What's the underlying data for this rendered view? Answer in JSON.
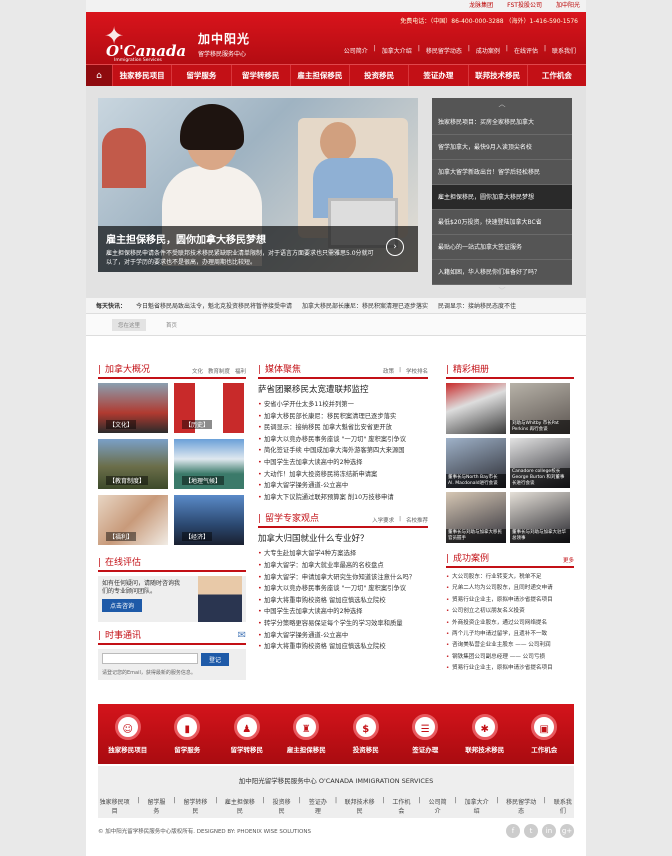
{
  "toplinks": [
    "龙脉集团",
    "FST投股公司",
    "加中阳光"
  ],
  "header": {
    "logo_en": "O'Canada",
    "logo_sub": "Immigration Services",
    "cn_title": "加中阳光",
    "cn_sub": "留学移民服务中心",
    "phone": "免费电话：（中国）86-400-000-3288 （海外）1-416-590-1576",
    "subnav": [
      "公司简介",
      "加拿大介绍",
      "移民留学动态",
      "成功案例",
      "在线评估",
      "联系我们"
    ]
  },
  "nav": [
    "独家移民项目",
    "留学服务",
    "留学转移民",
    "雇主担保移民",
    "投资移民",
    "签证办理",
    "联邦技术移民",
    "工作机会"
  ],
  "hero": {
    "title": "雇主担保移民，圆你加拿大移民梦想",
    "desc": "雇主担保移民申请条件不受联邦技术移民紧缺职业清单限制，对于语言方面要求也只需雅思5.0分就可以了，对于学历的要求也不是很高，办理周期也比较短。",
    "slides": [
      "独家移民项目：买房全家移民加拿大",
      "留学加拿大，最快9月入读顶尖名校",
      "加拿大留学新政出台！留学后轻松移民",
      "雇主担保移民，圆你加拿大移民梦想",
      "最低$20万投资，快速登陆加拿大BC省",
      "最贴心的一站式加拿大签证服务",
      "入籍如困，华人移民你们准备好了吗？"
    ]
  },
  "ticker": {
    "label": "每天快讯：",
    "items": [
      "今日魁省移民局致出法令，魁北克投资移民将暂停接受申请",
      "加拿大移民部长康尼：移民积案清理已逐步落实",
      "民调显示：接纳移民态度不佳"
    ]
  },
  "crumbs": [
    "您在这里",
    "首页"
  ],
  "col1": {
    "title": "加拿大概况",
    "tabs": [
      "文化",
      "教育制度",
      "福利"
    ],
    "tiles": [
      "【文化】",
      "【历史】",
      "【教育制度】",
      "【地理气候】",
      "【福利】",
      "【经济】"
    ],
    "assess_title": "在线评估",
    "assess_text": "如有任何疑问，请随时咨询我们的专业顾问团队。",
    "assess_btn": "点击咨询",
    "news_title": "时事通讯",
    "sub_btn": "登记",
    "sub_note": "请登记您的Email，获得最新的服务信息。"
  },
  "col2": {
    "title": "媒体聚焦",
    "tabs": [
      "政策",
      "学校排名"
    ],
    "headline": "萨省团聚移民太宽遭联邦监控",
    "items": [
      "安省小学开仕太多11校并列第一",
      "加拿大移民部长康尼：移民积案清理已逐步落实",
      "民调显示：接纳移民 加拿大魁省比安省更开放",
      "加拿大以竞办移民事务座谈 \"一刀切\" 废积案引争议",
      "简化签证手续 中国成加拿大海外游客第四大来源国",
      "中国学生去加拿大读高中的2种选择",
      "大动作！加拿大投资移民将冻结新申请案",
      "加拿大留学操务通道-公立高中",
      "加拿大下议院通过联邦预算案 削10万技移申请"
    ],
    "title2": "留学专家观点",
    "tabs2": [
      "入学要求",
      "名校推荐"
    ],
    "headline2": "加拿大归国就业什么专业好？",
    "items2": [
      "大专生赴加拿大留学4种方案选择",
      "加拿大留学：加拿大就业率最高的名校盘点",
      "加拿大留学：申请加拿大研究生你知道该注意什么吗？",
      "加拿大以竞办移民事务座谈 \"一刀切\" 废积案引争议",
      "加拿大将重审购校资格 留加应慎选私立院校",
      "中国学生去加拿大读高中的2种选择",
      "转学分策略更容易保证每个学生的学习效率和质量",
      "加拿大留学操务通道-公立高中",
      "加拿大将重审购校资格 留加应慎选私立院校"
    ]
  },
  "col3": {
    "title": "精彩相册",
    "captions": [
      "",
      "刘助与Whitby 市长Pat Perkins 再行会谈",
      "董事长与North Bay市长 Al. Macdonald进行会谈",
      "Canadore college校长 George Burton 和刘董事长进行会谈",
      "董事长与刘助与加拿大移民官员握手",
      "董事长与刘助与加拿大驻华总领事"
    ],
    "title2": "成功案例",
    "more": "更多",
    "items": [
      "大公司股东：行业转变大，税单不足",
      "兄弟二人均为公司股东，且同时递交申请",
      "贸易行业企业主，原拟申请沙省提名项目",
      "公司创立之初以朋友名义投资",
      "外商投资企业股东，通过公司网络提名",
      "两个儿子均申请过留学，且遗补不一致",
      "咨询美私营企业业主股东 —— 公司利润",
      "钢铁集团公司副总经理 —— 公司亏损",
      "贸易行业企业主，原拟申请沙省提名项目"
    ]
  },
  "footer": {
    "icons": [
      "独家移民项目",
      "留学服务",
      "留学转移民",
      "雇主担保移民",
      "投资移民",
      "签证办理",
      "联邦技术移民",
      "工作机会"
    ],
    "org": "加中阳光留学移民服务中心   O'CANADA IMMIGRATION SERVICES",
    "links": [
      "独家移民项目",
      "留学服务",
      "留学转移民",
      "雇主担保移民",
      "投资移民",
      "签证办理",
      "联邦技术移民",
      "工作机会",
      "公司简介",
      "加拿大介绍",
      "移民留学动态",
      "联系我们"
    ],
    "copy": "© 加中阳光留学移民服务中心版权所有.     DESIGNED BY: PHOENIX WISE SOLUTIONS"
  },
  "colors": {
    "brand": "#c31016"
  }
}
